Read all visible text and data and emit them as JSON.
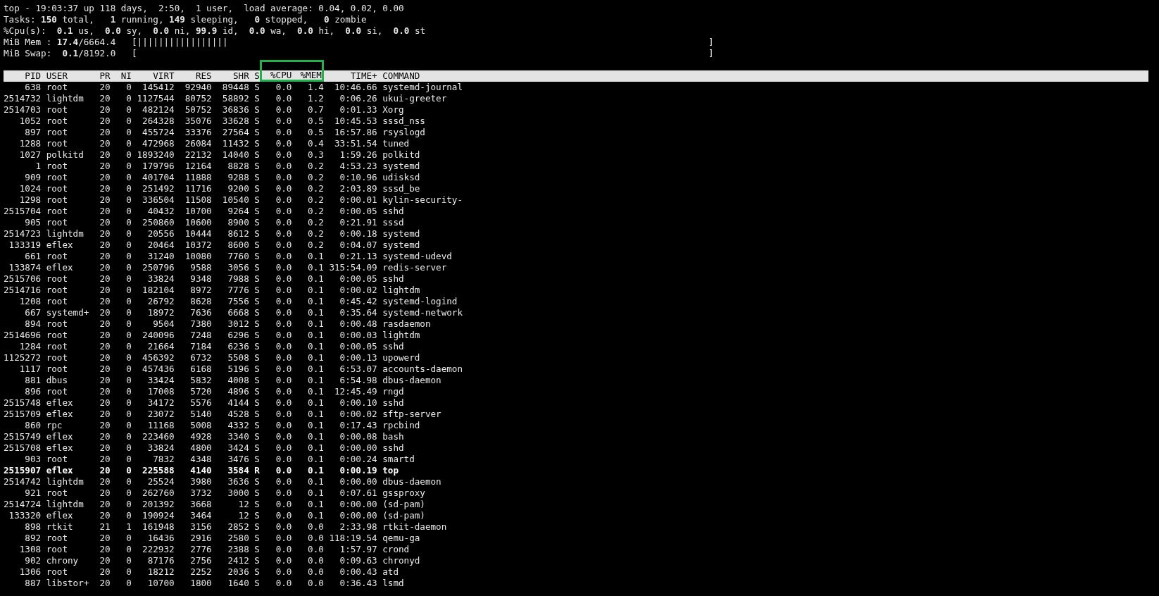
{
  "summary": [
    "top - 19:03:37 up 118 days,  2:50,  1 user,  load average: 0.04, 0.02, 0.00",
    "Tasks: **150** total,   **1** running, **149** sleeping,   **0** stopped,   **0** zombie",
    "%Cpu(s):  **0.1** us,  **0.0** sy,  **0.0** ni, **99.9** id,  **0.0** wa,  **0.0** hi,  **0.0** si,  **0.0** st"
  ],
  "memory": [
    {
      "label": "MiB Mem : **17.4**/6664.4   [|||||||||||||||||",
      "end": "]"
    },
    {
      "label": "MiB Swap:  **0.1**/8192.0   [",
      "end": "]"
    }
  ],
  "table": {
    "columns": [
      {
        "label": "PID",
        "highlighted": false
      },
      {
        "label": "USER",
        "highlighted": false
      },
      {
        "label": "PR",
        "highlighted": false
      },
      {
        "label": "NI",
        "highlighted": false
      },
      {
        "label": "VIRT",
        "highlighted": false
      },
      {
        "label": "RES",
        "highlighted": false
      },
      {
        "label": "SHR",
        "highlighted": false
      },
      {
        "label": "S",
        "highlighted": false
      },
      {
        "label": "%CPU",
        "highlighted": true
      },
      {
        "label": "%MEM",
        "highlighted": true
      },
      {
        "label": "TIME+",
        "highlighted": false
      },
      {
        "label": "COMMAND",
        "highlighted": false
      }
    ],
    "rows": [
      {
        "bold": false,
        "cells": [
          "638",
          "root",
          "20",
          "0",
          "145412",
          "92940",
          "89448",
          "S",
          "0.0",
          "1.4",
          "10:46.66",
          "systemd-journal"
        ]
      },
      {
        "bold": false,
        "cells": [
          "2514732",
          "lightdm",
          "20",
          "0",
          "1127544",
          "80752",
          "58892",
          "S",
          "0.0",
          "1.2",
          "0:06.26",
          "ukui-greeter"
        ]
      },
      {
        "bold": false,
        "cells": [
          "2514703",
          "root",
          "20",
          "0",
          "482124",
          "50752",
          "36836",
          "S",
          "0.0",
          "0.7",
          "0:01.33",
          "Xorg"
        ]
      },
      {
        "bold": false,
        "cells": [
          "1052",
          "root",
          "20",
          "0",
          "264328",
          "35076",
          "33628",
          "S",
          "0.0",
          "0.5",
          "10:45.53",
          "sssd_nss"
        ]
      },
      {
        "bold": false,
        "cells": [
          "897",
          "root",
          "20",
          "0",
          "455724",
          "33376",
          "27564",
          "S",
          "0.0",
          "0.5",
          "16:57.86",
          "rsyslogd"
        ]
      },
      {
        "bold": false,
        "cells": [
          "1288",
          "root",
          "20",
          "0",
          "472968",
          "26084",
          "11432",
          "S",
          "0.0",
          "0.4",
          "33:51.54",
          "tuned"
        ]
      },
      {
        "bold": false,
        "cells": [
          "1027",
          "polkitd",
          "20",
          "0",
          "1893240",
          "22132",
          "14040",
          "S",
          "0.0",
          "0.3",
          "1:59.26",
          "polkitd"
        ]
      },
      {
        "bold": false,
        "cells": [
          "1",
          "root",
          "20",
          "0",
          "179796",
          "12164",
          "8828",
          "S",
          "0.0",
          "0.2",
          "4:53.23",
          "systemd"
        ]
      },
      {
        "bold": false,
        "cells": [
          "909",
          "root",
          "20",
          "0",
          "401704",
          "11888",
          "9288",
          "S",
          "0.0",
          "0.2",
          "0:10.96",
          "udisksd"
        ]
      },
      {
        "bold": false,
        "cells": [
          "1024",
          "root",
          "20",
          "0",
          "251492",
          "11716",
          "9200",
          "S",
          "0.0",
          "0.2",
          "2:03.89",
          "sssd_be"
        ]
      },
      {
        "bold": false,
        "cells": [
          "1298",
          "root",
          "20",
          "0",
          "336504",
          "11508",
          "10540",
          "S",
          "0.0",
          "0.2",
          "0:00.01",
          "kylin-security-"
        ]
      },
      {
        "bold": false,
        "cells": [
          "2515704",
          "root",
          "20",
          "0",
          "40432",
          "10700",
          "9264",
          "S",
          "0.0",
          "0.2",
          "0:00.05",
          "sshd"
        ]
      },
      {
        "bold": false,
        "cells": [
          "905",
          "root",
          "20",
          "0",
          "250860",
          "10600",
          "8900",
          "S",
          "0.0",
          "0.2",
          "0:21.91",
          "sssd"
        ]
      },
      {
        "bold": false,
        "cells": [
          "2514723",
          "lightdm",
          "20",
          "0",
          "20556",
          "10444",
          "8612",
          "S",
          "0.0",
          "0.2",
          "0:00.18",
          "systemd"
        ]
      },
      {
        "bold": false,
        "cells": [
          "133319",
          "eflex",
          "20",
          "0",
          "20464",
          "10372",
          "8600",
          "S",
          "0.0",
          "0.2",
          "0:04.07",
          "systemd"
        ]
      },
      {
        "bold": false,
        "cells": [
          "661",
          "root",
          "20",
          "0",
          "31240",
          "10080",
          "7760",
          "S",
          "0.0",
          "0.1",
          "0:21.13",
          "systemd-udevd"
        ]
      },
      {
        "bold": false,
        "cells": [
          "133874",
          "eflex",
          "20",
          "0",
          "250796",
          "9588",
          "3056",
          "S",
          "0.0",
          "0.1",
          "315:54.09",
          "redis-server"
        ]
      },
      {
        "bold": false,
        "cells": [
          "2515706",
          "root",
          "20",
          "0",
          "33824",
          "9348",
          "7988",
          "S",
          "0.0",
          "0.1",
          "0:00.05",
          "sshd"
        ]
      },
      {
        "bold": false,
        "cells": [
          "2514716",
          "root",
          "20",
          "0",
          "182104",
          "8972",
          "7776",
          "S",
          "0.0",
          "0.1",
          "0:00.02",
          "lightdm"
        ]
      },
      {
        "bold": false,
        "cells": [
          "1208",
          "root",
          "20",
          "0",
          "26792",
          "8628",
          "7556",
          "S",
          "0.0",
          "0.1",
          "0:45.42",
          "systemd-logind"
        ]
      },
      {
        "bold": false,
        "cells": [
          "667",
          "systemd+",
          "20",
          "0",
          "18972",
          "7636",
          "6668",
          "S",
          "0.0",
          "0.1",
          "0:35.64",
          "systemd-network"
        ]
      },
      {
        "bold": false,
        "cells": [
          "894",
          "root",
          "20",
          "0",
          "9504",
          "7380",
          "3012",
          "S",
          "0.0",
          "0.1",
          "0:00.48",
          "rasdaemon"
        ]
      },
      {
        "bold": false,
        "cells": [
          "2514696",
          "root",
          "20",
          "0",
          "240096",
          "7248",
          "6296",
          "S",
          "0.0",
          "0.1",
          "0:00.03",
          "lightdm"
        ]
      },
      {
        "bold": false,
        "cells": [
          "1284",
          "root",
          "20",
          "0",
          "21664",
          "7184",
          "6236",
          "S",
          "0.0",
          "0.1",
          "0:00.05",
          "sshd"
        ]
      },
      {
        "bold": false,
        "cells": [
          "1125272",
          "root",
          "20",
          "0",
          "456392",
          "6732",
          "5508",
          "S",
          "0.0",
          "0.1",
          "0:00.13",
          "upowerd"
        ]
      },
      {
        "bold": false,
        "cells": [
          "1117",
          "root",
          "20",
          "0",
          "457436",
          "6168",
          "5196",
          "S",
          "0.0",
          "0.1",
          "6:53.07",
          "accounts-daemon"
        ]
      },
      {
        "bold": false,
        "cells": [
          "881",
          "dbus",
          "20",
          "0",
          "33424",
          "5832",
          "4008",
          "S",
          "0.0",
          "0.1",
          "6:54.98",
          "dbus-daemon"
        ]
      },
      {
        "bold": false,
        "cells": [
          "896",
          "root",
          "20",
          "0",
          "17008",
          "5720",
          "4896",
          "S",
          "0.0",
          "0.1",
          "12:45.49",
          "rngd"
        ]
      },
      {
        "bold": false,
        "cells": [
          "2515748",
          "eflex",
          "20",
          "0",
          "34172",
          "5576",
          "4144",
          "S",
          "0.0",
          "0.1",
          "0:00.10",
          "sshd"
        ]
      },
      {
        "bold": false,
        "cells": [
          "2515709",
          "eflex",
          "20",
          "0",
          "23072",
          "5140",
          "4528",
          "S",
          "0.0",
          "0.1",
          "0:00.02",
          "sftp-server"
        ]
      },
      {
        "bold": false,
        "cells": [
          "860",
          "rpc",
          "20",
          "0",
          "11168",
          "5008",
          "4332",
          "S",
          "0.0",
          "0.1",
          "0:17.43",
          "rpcbind"
        ]
      },
      {
        "bold": false,
        "cells": [
          "2515749",
          "eflex",
          "20",
          "0",
          "223460",
          "4928",
          "3340",
          "S",
          "0.0",
          "0.1",
          "0:00.08",
          "bash"
        ]
      },
      {
        "bold": false,
        "cells": [
          "2515708",
          "eflex",
          "20",
          "0",
          "33824",
          "4800",
          "3424",
          "S",
          "0.0",
          "0.1",
          "0:00.00",
          "sshd"
        ]
      },
      {
        "bold": false,
        "cells": [
          "903",
          "root",
          "20",
          "0",
          "7832",
          "4348",
          "3476",
          "S",
          "0.0",
          "0.1",
          "0:00.24",
          "smartd"
        ]
      },
      {
        "bold": true,
        "cells": [
          "2515907",
          "eflex",
          "20",
          "0",
          "225588",
          "4140",
          "3584",
          "R",
          "0.0",
          "0.1",
          "0:00.19",
          "top"
        ]
      },
      {
        "bold": false,
        "cells": [
          "2514742",
          "lightdm",
          "20",
          "0",
          "25524",
          "3980",
          "3636",
          "S",
          "0.0",
          "0.1",
          "0:00.00",
          "dbus-daemon"
        ]
      },
      {
        "bold": false,
        "cells": [
          "921",
          "root",
          "20",
          "0",
          "262760",
          "3732",
          "3000",
          "S",
          "0.0",
          "0.1",
          "0:07.61",
          "gssproxy"
        ]
      },
      {
        "bold": false,
        "cells": [
          "2514724",
          "lightdm",
          "20",
          "0",
          "201392",
          "3668",
          "12",
          "S",
          "0.0",
          "0.1",
          "0:00.00",
          "(sd-pam)"
        ]
      },
      {
        "bold": false,
        "cells": [
          "133320",
          "eflex",
          "20",
          "0",
          "190924",
          "3464",
          "12",
          "S",
          "0.0",
          "0.1",
          "0:00.00",
          "(sd-pam)"
        ]
      },
      {
        "bold": false,
        "cells": [
          "898",
          "rtkit",
          "21",
          "1",
          "161948",
          "3156",
          "2852",
          "S",
          "0.0",
          "0.0",
          "2:33.98",
          "rtkit-daemon"
        ]
      },
      {
        "bold": false,
        "cells": [
          "892",
          "root",
          "20",
          "0",
          "16436",
          "2916",
          "2580",
          "S",
          "0.0",
          "0.0",
          "118:19.54",
          "qemu-ga"
        ]
      },
      {
        "bold": false,
        "cells": [
          "1308",
          "root",
          "20",
          "0",
          "222932",
          "2776",
          "2388",
          "S",
          "0.0",
          "0.0",
          "1:57.97",
          "crond"
        ]
      },
      {
        "bold": false,
        "cells": [
          "902",
          "chrony",
          "20",
          "0",
          "87176",
          "2756",
          "2412",
          "S",
          "0.0",
          "0.0",
          "0:09.63",
          "chronyd"
        ]
      },
      {
        "bold": false,
        "cells": [
          "1306",
          "root",
          "20",
          "0",
          "18212",
          "2252",
          "2036",
          "S",
          "0.0",
          "0.0",
          "0:00.43",
          "atd"
        ]
      },
      {
        "bold": false,
        "cells": [
          "887",
          "libstor+",
          "20",
          "0",
          "10700",
          "1800",
          "1640",
          "S",
          "0.0",
          "0.0",
          "0:36.43",
          "lsmd"
        ]
      }
    ]
  }
}
